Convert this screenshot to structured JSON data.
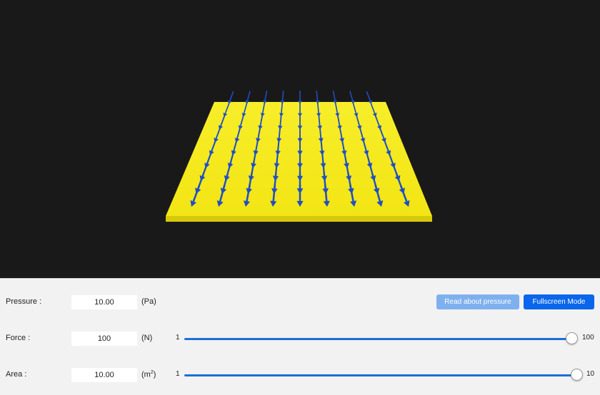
{
  "scene": {
    "background_color": "#1a1919",
    "plate_color": "#f5ea1c",
    "arrow_color": "#1f4fc4"
  },
  "controls": {
    "pressure": {
      "label": "Pressure :",
      "value": "10.00",
      "unit": "(Pa)"
    },
    "force": {
      "label": "Force :",
      "value": "100",
      "unit": "(N)",
      "slider_min": "1",
      "slider_max": "100",
      "slider_value": 100
    },
    "area": {
      "label": "Area :",
      "value": "10.00",
      "unit_base": "(m",
      "unit_exp": "2",
      "unit_close": ")",
      "slider_min": "1",
      "slider_max": "10",
      "slider_value": 10
    }
  },
  "buttons": {
    "read_label": "Read about pressure",
    "fullscreen_label": "Fullscreen Mode"
  },
  "colors": {
    "accent": "#0a66ea",
    "accent_light": "#7fb0ee",
    "slider_track": "#1a6fd6",
    "panel_bg": "#f2f2f2"
  }
}
